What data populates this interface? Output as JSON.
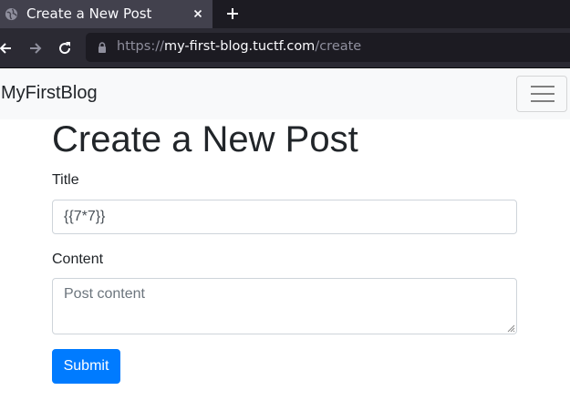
{
  "browser": {
    "tab": {
      "title": "Create a New Post",
      "icon": "globe-icon"
    },
    "url": {
      "scheme": "https://",
      "host": "my-first-blog.tuctf.com",
      "path": "/create"
    }
  },
  "site": {
    "brand": "MyFirstBlog"
  },
  "page": {
    "heading": "Create a New Post",
    "form": {
      "title_label": "Title",
      "title_value": "{{7*7}}",
      "content_label": "Content",
      "content_placeholder": "Post content",
      "submit_label": "Submit"
    }
  },
  "colors": {
    "primary": "#007bff",
    "chrome_dark": "#1c1b22",
    "navbar_bg": "#f8f9fa"
  }
}
